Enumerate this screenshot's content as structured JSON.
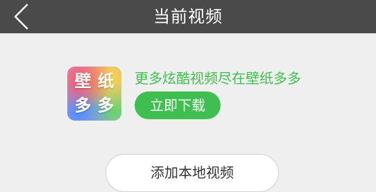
{
  "header": {
    "title": "当前视频",
    "back_icon": "chevron-left-icon"
  },
  "promo": {
    "icon_chars": [
      "壁",
      "纸",
      "多",
      "多"
    ],
    "text": "更多炫酷视频尽在壁纸多多",
    "download_label": "立即下载",
    "accent_color": "#3fbf4f"
  },
  "actions": {
    "add_local_label": "添加本地视频"
  },
  "colors": {
    "topbar": "#4a4a4a",
    "background": "#efefef"
  }
}
